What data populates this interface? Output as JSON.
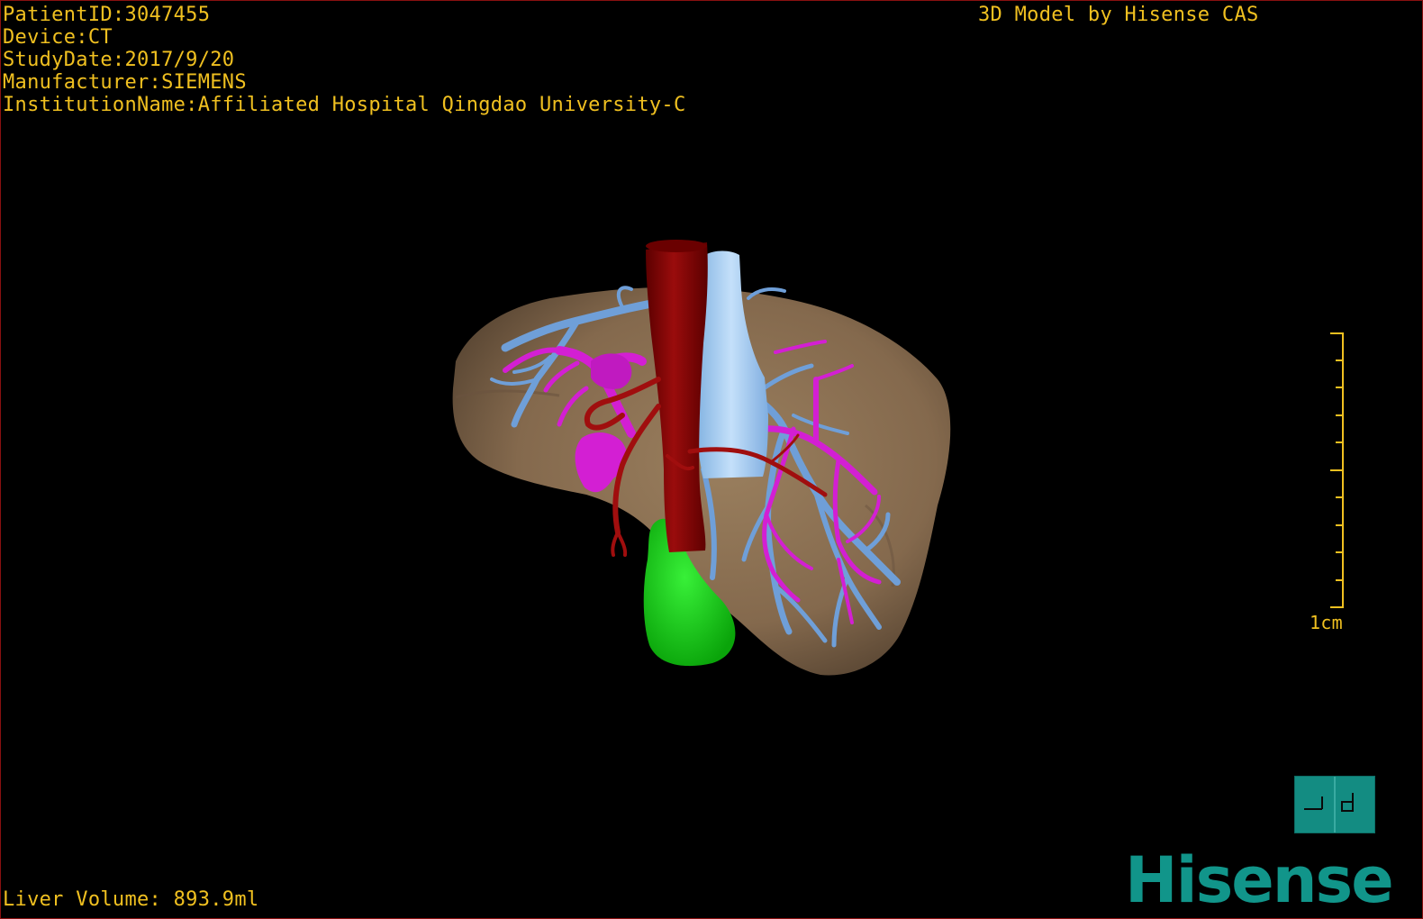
{
  "study_info": {
    "patient_id": "PatientID:3047455",
    "device": "Device:CT",
    "study_date": "StudyDate:2017/9/20",
    "manufacturer": "Manufacturer:SIEMENS",
    "institution": "InstitutionName:Affiliated Hospital Qingdao University-C"
  },
  "model_credit": "3D Model by Hisense CAS",
  "liver_volume": "Liver Volume: 893.9ml",
  "scale": {
    "label": "1cm",
    "tick_count": 10
  },
  "view_button": {
    "icon": "orientation-cube-icon"
  },
  "brand": {
    "name": "Hisense",
    "color": "#11958a"
  },
  "colors": {
    "overlay_text": "#f0c020",
    "liver": "#8b7355",
    "artery": "#8b0000",
    "vena_cava": "#a8cdf0",
    "hepatic_veins": "#6f9fd8",
    "portal_vein": "#d31fd3",
    "gallbladder": "#15d615"
  }
}
